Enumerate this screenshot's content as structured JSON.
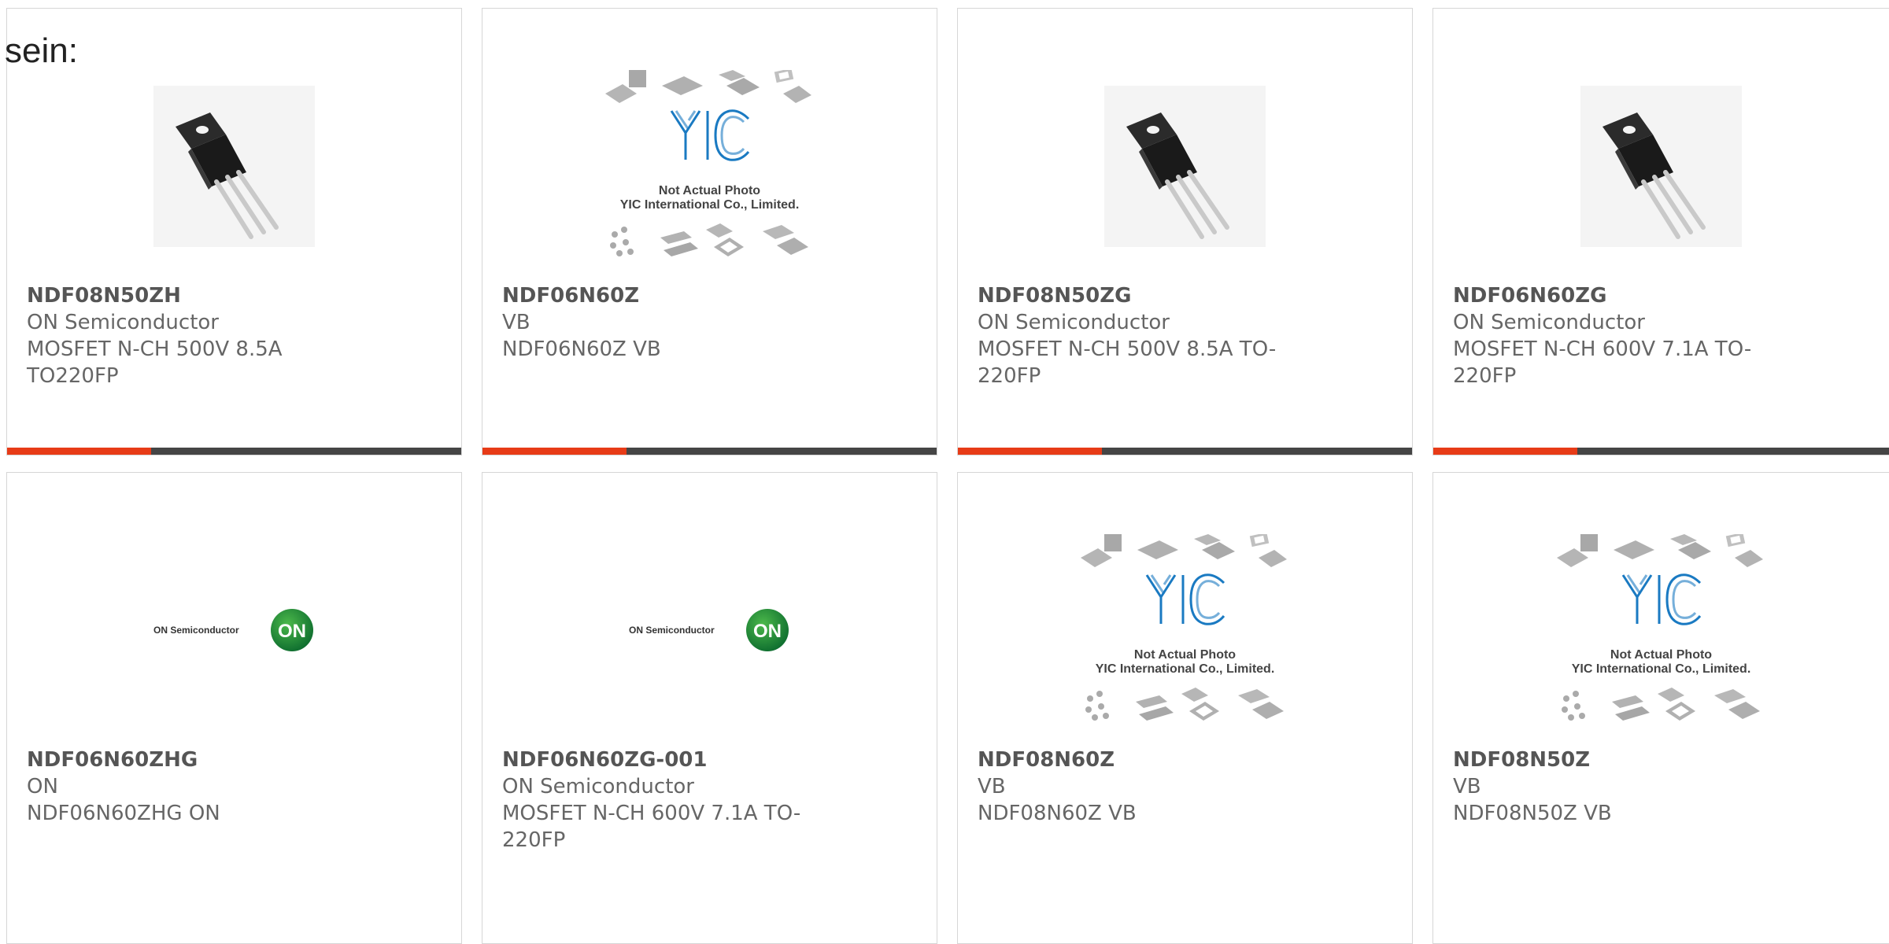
{
  "heading": "sein:",
  "image_text": {
    "yic_line1": "Not Actual Photo",
    "yic_line2": "YIC International Co., Limited.",
    "on_semi": "ON Semiconductor",
    "on_badge": "ON"
  },
  "colors": {
    "accent": "#e73b17",
    "bar": "#454545"
  },
  "products": [
    {
      "part": "NDF08N50ZH",
      "manufacturer": "ON Semiconductor",
      "desc1": "MOSFET N-CH 500V 8.5A",
      "desc2": "TO220FP",
      "image": "to220-transistor"
    },
    {
      "part": "NDF06N60Z",
      "manufacturer": "VB",
      "desc1": "NDF06N60Z VB",
      "desc2": "",
      "image": "yic-placeholder"
    },
    {
      "part": "NDF08N50ZG",
      "manufacturer": "ON Semiconductor",
      "desc1": "MOSFET N-CH 500V 8.5A TO-",
      "desc2": "220FP",
      "image": "to220-transistor"
    },
    {
      "part": "NDF06N60ZG",
      "manufacturer": "ON Semiconductor",
      "desc1": "MOSFET N-CH 600V 7.1A TO-",
      "desc2": "220FP",
      "image": "to220-transistor"
    },
    {
      "part": "NDF06N60ZHG",
      "manufacturer": "ON",
      "desc1": "NDF06N60ZHG ON",
      "desc2": "",
      "image": "on-semiconductor-logo"
    },
    {
      "part": "NDF06N60ZG-001",
      "manufacturer": "ON Semiconductor",
      "desc1": "MOSFET N-CH 600V 7.1A TO-",
      "desc2": "220FP",
      "image": "on-semiconductor-logo"
    },
    {
      "part": "NDF08N60Z",
      "manufacturer": "VB",
      "desc1": "NDF08N60Z VB",
      "desc2": "",
      "image": "yic-placeholder"
    },
    {
      "part": "NDF08N50Z",
      "manufacturer": "VB",
      "desc1": "NDF08N50Z VB",
      "desc2": "",
      "image": "yic-placeholder"
    }
  ]
}
